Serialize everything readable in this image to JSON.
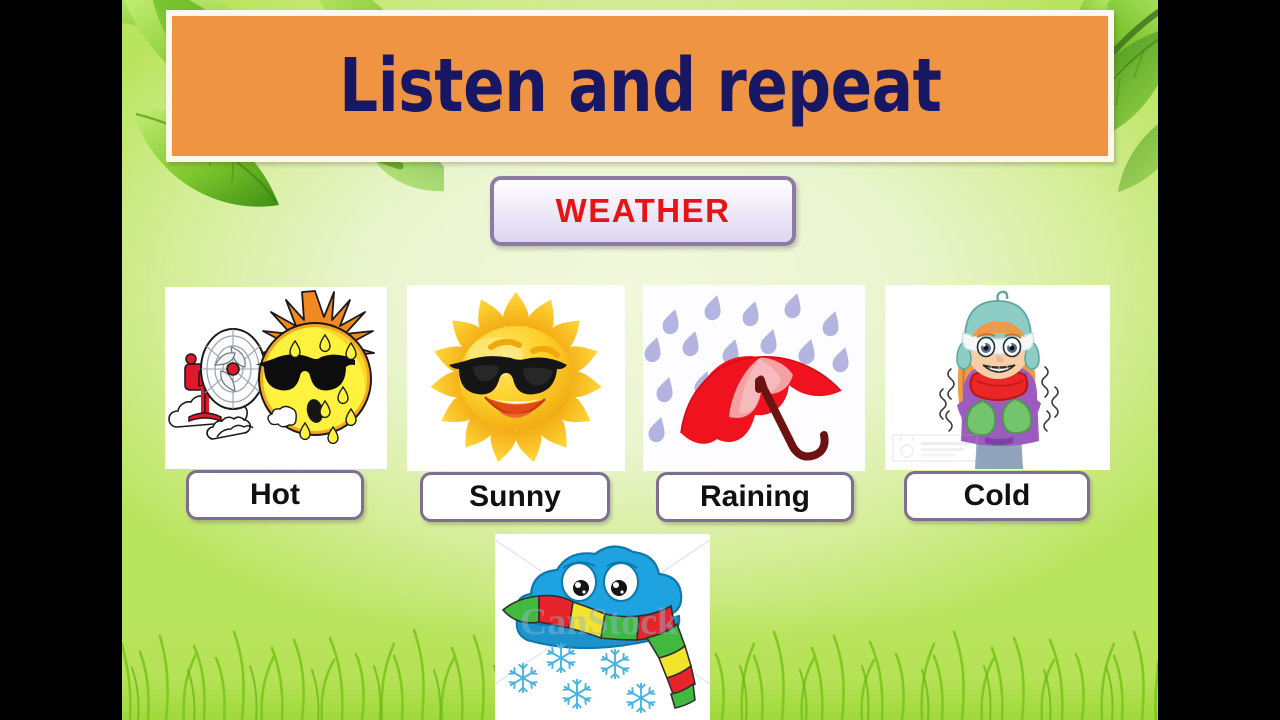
{
  "slide": {
    "title": "Listen and repeat",
    "topic_label": "WEATHER",
    "colors": {
      "banner_bg": "#ef9443",
      "banner_border": "#fdf7ec",
      "title_text": "#171764",
      "topic_text": "#e81414",
      "topic_border": "#8c7ca3",
      "word_border": "#7e6f92",
      "word_text": "#111111",
      "background_light": "#eaf5cf",
      "background_green": "#b9e45e",
      "grass": "#9fd93a",
      "letterbox": "#000000"
    }
  },
  "cards": [
    {
      "id": "hot",
      "label": "Hot",
      "image_name": "sweating-sun-with-sunglasses-and-electric-fan-illustration",
      "watermark": ""
    },
    {
      "id": "sunny",
      "label": "Sunny",
      "image_name": "smiling-sun-with-sunglasses-illustration",
      "watermark": ""
    },
    {
      "id": "raining",
      "label": "Raining",
      "image_name": "red-umbrella-with-raindrops-illustration",
      "watermark": ""
    },
    {
      "id": "cold",
      "label": "Cold",
      "image_name": "shivering-girl-in-winter-clothes-illustration",
      "watermark": "can stock photo"
    },
    {
      "id": "snowing",
      "label": "",
      "image_name": "blue-cloud-with-striped-scarf-and-snowflakes-illustration",
      "watermark": "CanStock"
    }
  ]
}
